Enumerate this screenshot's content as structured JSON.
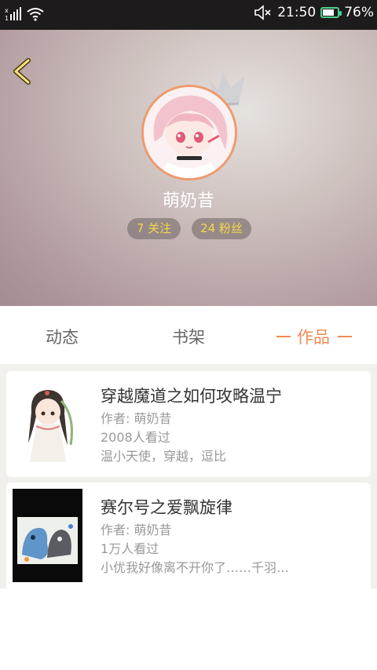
{
  "status_bar": {
    "time": "21:50",
    "battery": "76%",
    "battery_level": 0.76
  },
  "profile": {
    "username": "萌奶昔",
    "follow_label": "7 关注",
    "fans_label": "24 粉丝"
  },
  "tabs": [
    {
      "label": "动态",
      "active": false
    },
    {
      "label": "书架",
      "active": false
    },
    {
      "label": "作品",
      "active": true
    }
  ],
  "works": [
    {
      "title": "穿越魔道之如何攻略温宁",
      "author": "作者: 萌奶昔",
      "views": "2008人看过",
      "tags": "温小天使，穿越，逗比"
    },
    {
      "title": "赛尔号之爱飘旋律",
      "author": "作者: 萌奶昔",
      "views": "1万人看过",
      "tags": "小优我好像离不开你了……千羽…"
    }
  ],
  "colors": {
    "accent": "#ef8a55",
    "pill_text": "#f6d84a",
    "status_bar": "#1d1b1c",
    "battery": "#4ad08a"
  },
  "icons": {
    "back": "chevron-left-icon",
    "mute": "mute-icon",
    "wifi": "wifi-icon",
    "signal": "signal-icon",
    "battery": "battery-icon",
    "crown": "crown-icon"
  }
}
